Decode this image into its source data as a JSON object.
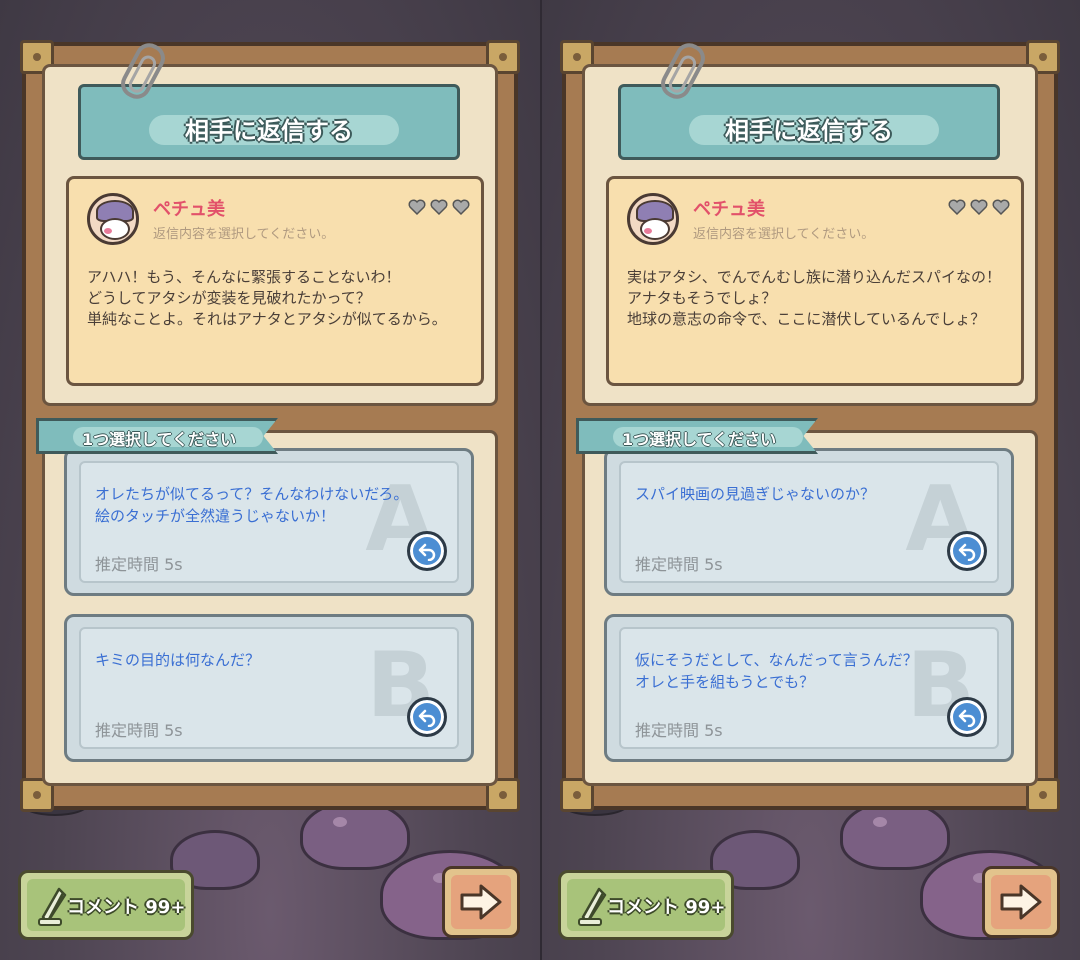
{
  "title": "相手に返信する",
  "select_prompt": "1つ選択してください",
  "comment_button": "コメント 99+",
  "screens": [
    {
      "sender": {
        "name": "ペチュ美",
        "hint": "返信内容を選択してください。"
      },
      "message": "アハハ！もう、そんなに緊張することないわ！\nどうしてアタシが変装を見破れたかって？\n単純なことよ。それはアナタとアタシが似てるから。",
      "options": [
        {
          "letter": "A",
          "text": "オレたちが似てるって？そんなわけないだろ。\n絵のタッチが全然違うじゃないか！",
          "time": "推定時間 5s"
        },
        {
          "letter": "B",
          "text": "キミの目的は何なんだ？",
          "time": "推定時間 5s"
        }
      ]
    },
    {
      "sender": {
        "name": "ペチュ美",
        "hint": "返信内容を選択してください。"
      },
      "message": "実はアタシ、でんでんむし族に潜り込んだスパイなの！\nアナタもそうでしょ？\n地球の意志の命令で、ここに潜伏しているんでしょ？",
      "options": [
        {
          "letter": "A",
          "text": "スパイ映画の見過ぎじゃないのか？",
          "time": "推定時間 5s"
        },
        {
          "letter": "B",
          "text": "仮にそうだとして、なんだって言うんだ？\nオレと手を組もうとでも？",
          "time": "推定時間 5s"
        }
      ]
    }
  ],
  "icons": [
    "paperclip-icon",
    "heart-icon",
    "reply-arrow-icon",
    "quill-icon",
    "right-arrow-icon"
  ],
  "colors": {
    "title_teal": "#7fbcbc",
    "name_red": "#e2516a",
    "option_text_blue": "#3a6fd3",
    "paper": "#efe2c6"
  }
}
